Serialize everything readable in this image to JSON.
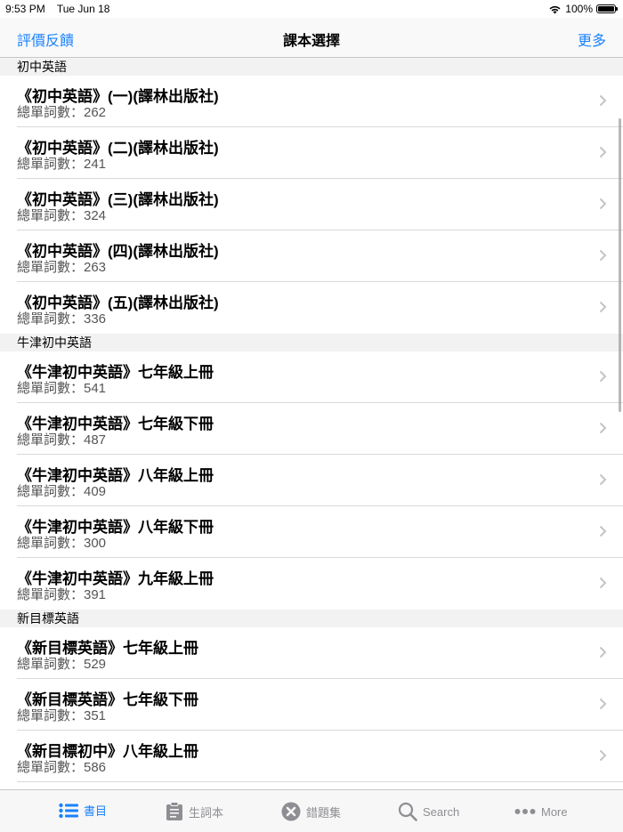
{
  "status_bar": {
    "time": "9:53 PM",
    "date": "Tue Jun 18",
    "battery": "100%"
  },
  "nav": {
    "left": "評價反饋",
    "title": "課本選擇",
    "right": "更多"
  },
  "sections": [
    {
      "header": "初中英語",
      "rows": [
        {
          "title": "《初中英語》(一)(譯林出版社)",
          "subtitle": "總單詞數：262"
        },
        {
          "title": "《初中英語》(二)(譯林出版社)",
          "subtitle": "總單詞數：241"
        },
        {
          "title": "《初中英語》(三)(譯林出版社)",
          "subtitle": "總單詞數：324"
        },
        {
          "title": "《初中英語》(四)(譯林出版社)",
          "subtitle": "總單詞數：263"
        },
        {
          "title": "《初中英語》(五)(譯林出版社)",
          "subtitle": "總單詞數：336"
        }
      ]
    },
    {
      "header": "牛津初中英語",
      "rows": [
        {
          "title": "《牛津初中英語》七年級上冊",
          "subtitle": "總單詞數：541"
        },
        {
          "title": "《牛津初中英語》七年級下冊",
          "subtitle": "總單詞數：487"
        },
        {
          "title": "《牛津初中英語》八年級上冊",
          "subtitle": "總單詞數：409"
        },
        {
          "title": "《牛津初中英語》八年級下冊",
          "subtitle": "總單詞數：300"
        },
        {
          "title": "《牛津初中英語》九年級上冊",
          "subtitle": "總單詞數：391"
        }
      ]
    },
    {
      "header": "新目標英語",
      "rows": [
        {
          "title": "《新目標英語》七年級上冊",
          "subtitle": "總單詞數：529"
        },
        {
          "title": "《新目標英語》七年級下冊",
          "subtitle": "總單詞數：351"
        },
        {
          "title": "《新目標初中》八年級上冊",
          "subtitle": "總單詞數：586"
        }
      ]
    }
  ],
  "tabs": [
    {
      "label": "書目",
      "icon": "list-icon",
      "active": true
    },
    {
      "label": "生詞本",
      "icon": "clipboard-icon",
      "active": false
    },
    {
      "label": "錯題集",
      "icon": "x-circle-icon",
      "active": false
    },
    {
      "label": "Search",
      "icon": "search-icon",
      "active": false
    },
    {
      "label": "More",
      "icon": "more-dots-icon",
      "active": false
    }
  ],
  "colors": {
    "accent": "#1a82fb",
    "inactive": "#8e8e93"
  }
}
